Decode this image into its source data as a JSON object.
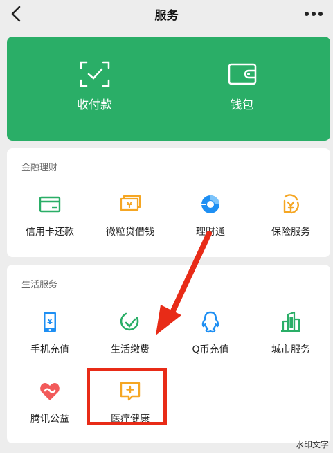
{
  "nav": {
    "title": "服务"
  },
  "wallet_panel": {
    "items": [
      {
        "label": "收付款",
        "icon": "scan-pay-icon"
      },
      {
        "label": "钱包",
        "icon": "wallet-icon"
      }
    ]
  },
  "finance": {
    "title": "金融理财",
    "items": [
      {
        "label": "信用卡还款",
        "icon": "credit-card-icon"
      },
      {
        "label": "微粒贷借钱",
        "icon": "cash-icon"
      },
      {
        "label": "理财通",
        "icon": "licaitong-icon"
      },
      {
        "label": "保险服务",
        "icon": "insurance-icon"
      }
    ]
  },
  "life": {
    "title": "生活服务",
    "items": [
      {
        "label": "手机充值",
        "icon": "phone-topup-icon"
      },
      {
        "label": "生活缴费",
        "icon": "bill-pay-icon"
      },
      {
        "label": "Q币充值",
        "icon": "qq-coin-icon"
      },
      {
        "label": "城市服务",
        "icon": "city-service-icon"
      },
      {
        "label": "腾讯公益",
        "icon": "charity-heart-icon"
      },
      {
        "label": "医疗健康",
        "icon": "medical-health-icon"
      }
    ]
  },
  "colors": {
    "green": "#2aae67",
    "orange": "#f5a623",
    "blue": "#1e8ff3",
    "red_annotation": "#e82b17",
    "charity": "#f25a5a"
  },
  "watermark": "水印文字"
}
